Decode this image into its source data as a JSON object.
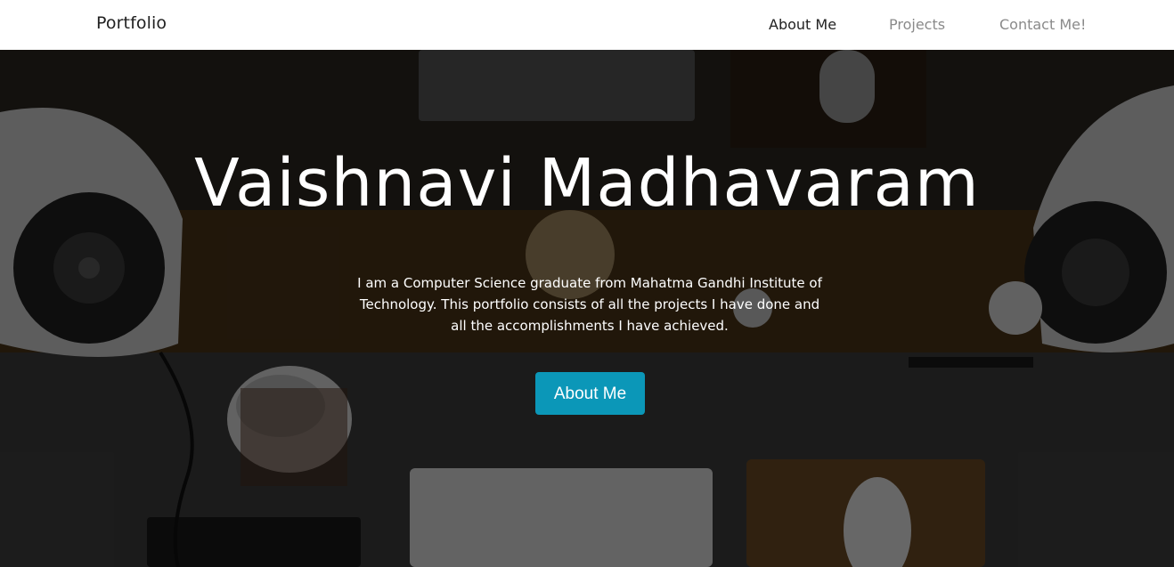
{
  "navbar": {
    "brand": "Portfolio",
    "links": [
      {
        "label": "About Me"
      },
      {
        "label": "Projects"
      },
      {
        "label": "Contact Me!"
      }
    ]
  },
  "hero": {
    "title": "Vaishnavi Madhavaram",
    "description": "I am a Computer Science graduate from Mahatma Gandhi Institute of Technology. This portfolio consists of all the projects I have done and all the accomplishments I have achieved.",
    "button_label": "About Me",
    "button_color": "#0b97b8",
    "background_icon": "desk-workspace-photo"
  }
}
